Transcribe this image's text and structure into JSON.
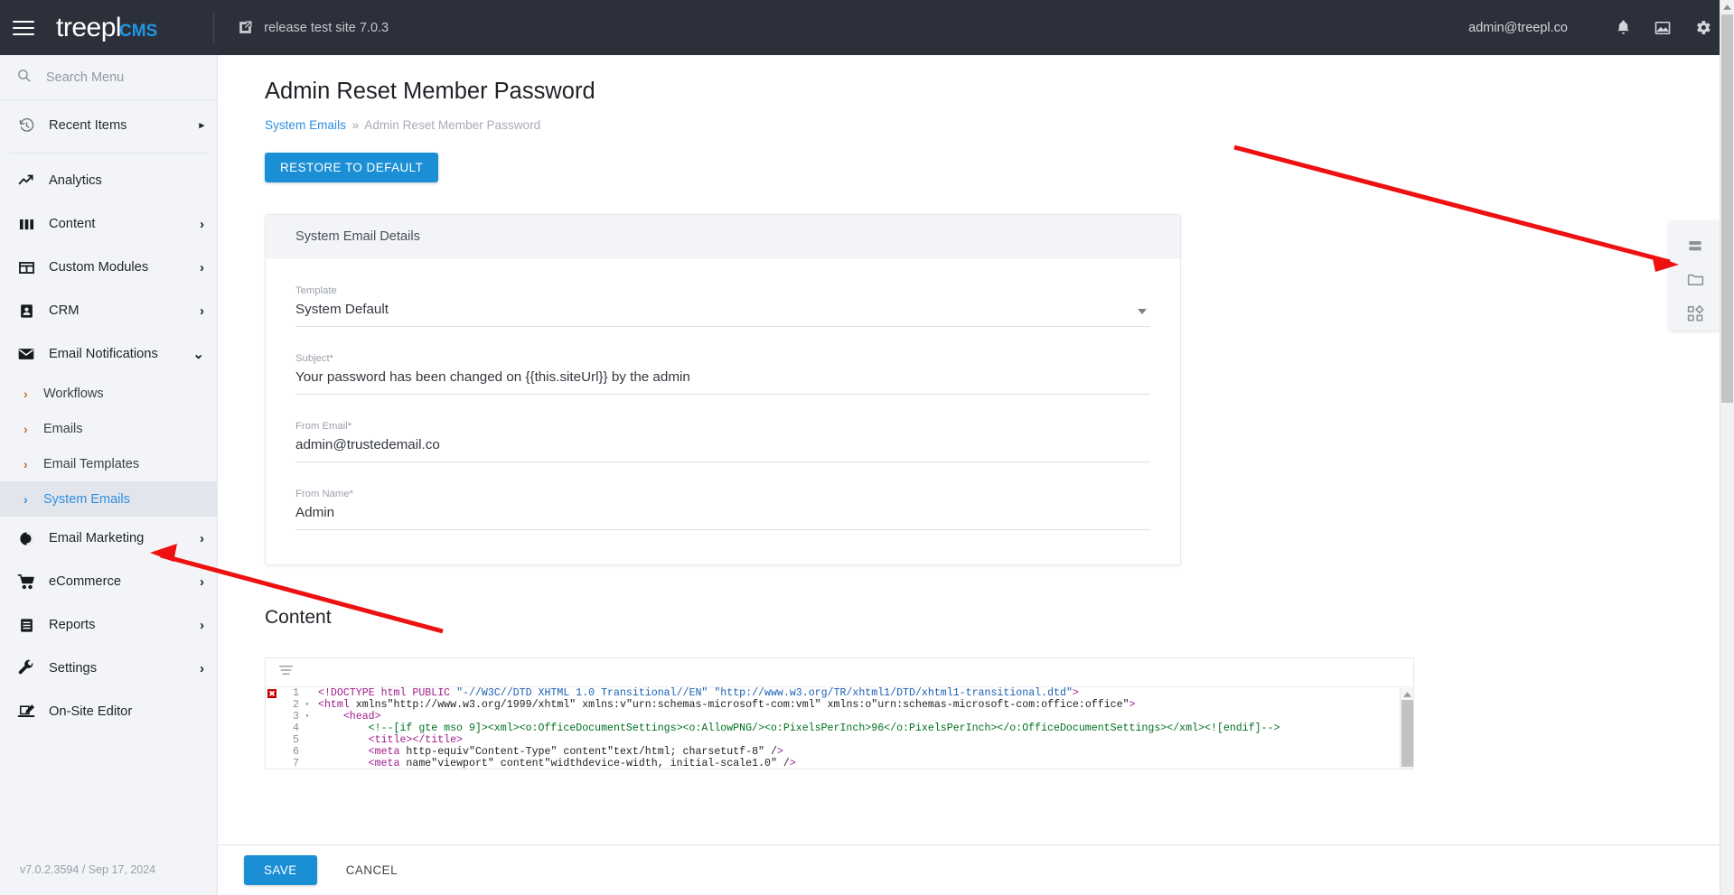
{
  "header": {
    "brand_main": "treepl",
    "brand_sub": "CMS",
    "site_name": "release test site 7.0.3",
    "user_email": "admin@treepl.co",
    "menu_icon": "hamburger-menu-icon",
    "site_icon": "external-link-icon",
    "notification_icon": "bell-icon",
    "media_icon": "image-icon",
    "settings_icon": "gear-icon"
  },
  "sidebar": {
    "search_placeholder": "Search Menu",
    "search_value": "",
    "search_icon": "search-icon",
    "recent": {
      "label": "Recent Items",
      "icon": "history-clock-icon",
      "caret": "▸"
    },
    "items": [
      {
        "label": "Analytics",
        "icon": "trending-up-icon",
        "caret": ""
      },
      {
        "label": "Content",
        "icon": "columns-icon",
        "caret": "›"
      },
      {
        "label": "Custom Modules",
        "icon": "module-layout-icon",
        "caret": "›"
      },
      {
        "label": "CRM",
        "icon": "person-card-icon",
        "caret": "›"
      },
      {
        "label": "Email Notifications",
        "icon": "envelope-icon",
        "caret": "⌄"
      }
    ],
    "subitems": [
      {
        "label": "Workflows",
        "chev": "›",
        "active": false
      },
      {
        "label": "Emails",
        "chev": "›",
        "active": false
      },
      {
        "label": "Email Templates",
        "chev": "›",
        "active": false
      },
      {
        "label": "System Emails",
        "chev": "›",
        "active": true
      }
    ],
    "items_after": [
      {
        "label": "Email Marketing",
        "icon": "pie-chart-icon",
        "caret": "›"
      },
      {
        "label": "eCommerce",
        "icon": "shopping-cart-icon",
        "caret": "›"
      },
      {
        "label": "Reports",
        "icon": "document-lines-icon",
        "caret": "›"
      },
      {
        "label": "Settings",
        "icon": "wrench-icon",
        "caret": "›"
      },
      {
        "label": "On-Site Editor",
        "icon": "laptop-edit-icon",
        "caret": ""
      }
    ],
    "version": "v7.0.2.3594 / Sep 17, 2024"
  },
  "page": {
    "title": "Admin Reset Member Password",
    "breadcrumb_link": "System Emails",
    "breadcrumb_sep": "»",
    "breadcrumb_current": "Admin Reset Member Password",
    "restore_label": "RESTORE TO DEFAULT"
  },
  "card": {
    "header": "System Email Details",
    "fields": [
      {
        "label": "Template",
        "value": "System Default",
        "type": "select"
      },
      {
        "label": "Subject*",
        "value": "Your password has been changed on {{this.siteUrl}} by the admin",
        "type": "text"
      },
      {
        "label": "From Email*",
        "value": "admin@trustedemail.co",
        "type": "text"
      },
      {
        "label": "From Name*",
        "value": "Admin",
        "type": "text"
      }
    ]
  },
  "content_section": {
    "heading": "Content",
    "editor_toolbar_icon": "format-lines-icon",
    "error_marker": "✖",
    "lines": [
      {
        "num": "1",
        "fold": "",
        "error": true,
        "text": "<!DOCTYPE html PUBLIC \"-//W3C//DTD XHTML 1.0 Transitional//EN\" \"http://www.w3.org/TR/xhtml1/DTD/xhtml1-transitional.dtd\">"
      },
      {
        "num": "2",
        "fold": "▾",
        "error": false,
        "text": "<html xmlns=\"http://www.w3.org/1999/xhtml\" xmlns:v=\"urn:schemas-microsoft-com:vml\" xmlns:o=\"urn:schemas-microsoft-com:office:office\">"
      },
      {
        "num": "3",
        "fold": "▾",
        "error": false,
        "text": "    <head>"
      },
      {
        "num": "4",
        "fold": "",
        "error": false,
        "text": "        <!--[if gte mso 9]><xml><o:OfficeDocumentSettings><o:AllowPNG/><o:PixelsPerInch>96</o:PixelsPerInch></o:OfficeDocumentSettings></xml><![endif]-->"
      },
      {
        "num": "5",
        "fold": "",
        "error": false,
        "text": "        <title></title>"
      },
      {
        "num": "6",
        "fold": "",
        "error": false,
        "text": "        <meta http-equiv=\"Content-Type\" content=\"text/html; charset=utf-8\" />"
      },
      {
        "num": "7",
        "fold": "",
        "error": false,
        "text": "        <meta name=\"viewport\" content=\"width=device-width, initial-scale=1.0\" />"
      }
    ]
  },
  "actionbar": {
    "save_label": "SAVE",
    "cancel_label": "CANCEL"
  },
  "toolpanel": {
    "items": [
      {
        "icon": "rows-layout-icon"
      },
      {
        "icon": "folder-icon"
      },
      {
        "icon": "modules-grid-icon"
      }
    ]
  },
  "colors": {
    "header_bg": "#2b303a",
    "sidebar_bg": "#f2f4f8",
    "accent_blue": "#1b8fd6",
    "link_blue": "#2e8fe0",
    "annotation_red": "#ee1111"
  }
}
